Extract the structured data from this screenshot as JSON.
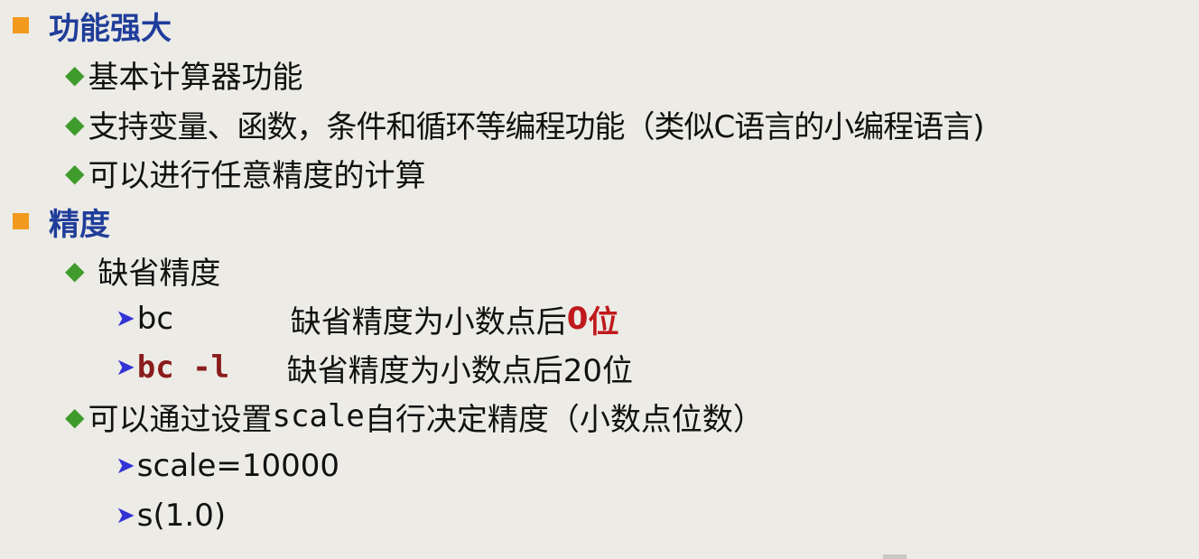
{
  "section1": {
    "heading": "功能强大",
    "items": [
      "基本计算器功能",
      "支持变量、函数，条件和循环等编程功能（类似C语言的小编程语言)",
      "可以进行任意精度的计算"
    ]
  },
  "section2": {
    "heading": "精度",
    "default_label": " 缺省精度",
    "bc": {
      "cmd": "bc",
      "desc": "缺省精度为小数点后",
      "digit": "0",
      "unit": "位"
    },
    "bcl": {
      "cmd": "bc -l",
      "desc": "缺省精度为小数点后20位"
    },
    "scale_line": {
      "pre": "可以通过设置",
      "keyword": "scale",
      "post": "自行决定精度（小数点位数）"
    },
    "examples": [
      "scale=10000",
      "s(1.0)"
    ]
  },
  "colors": {
    "background": "#ecebe6",
    "square_bullet": "#f39a1e",
    "heading": "#1f3d9a",
    "diamond_bullet": "#3f9b2c",
    "arrow_bullet": "#3333d6",
    "code_red": "#8b1c1c",
    "emphasis_red": "#c0191c"
  },
  "icons": {
    "square": "orange-square-bullet",
    "diamond": "green-diamond-bullet",
    "arrow": "blue-arrowhead-bullet"
  }
}
